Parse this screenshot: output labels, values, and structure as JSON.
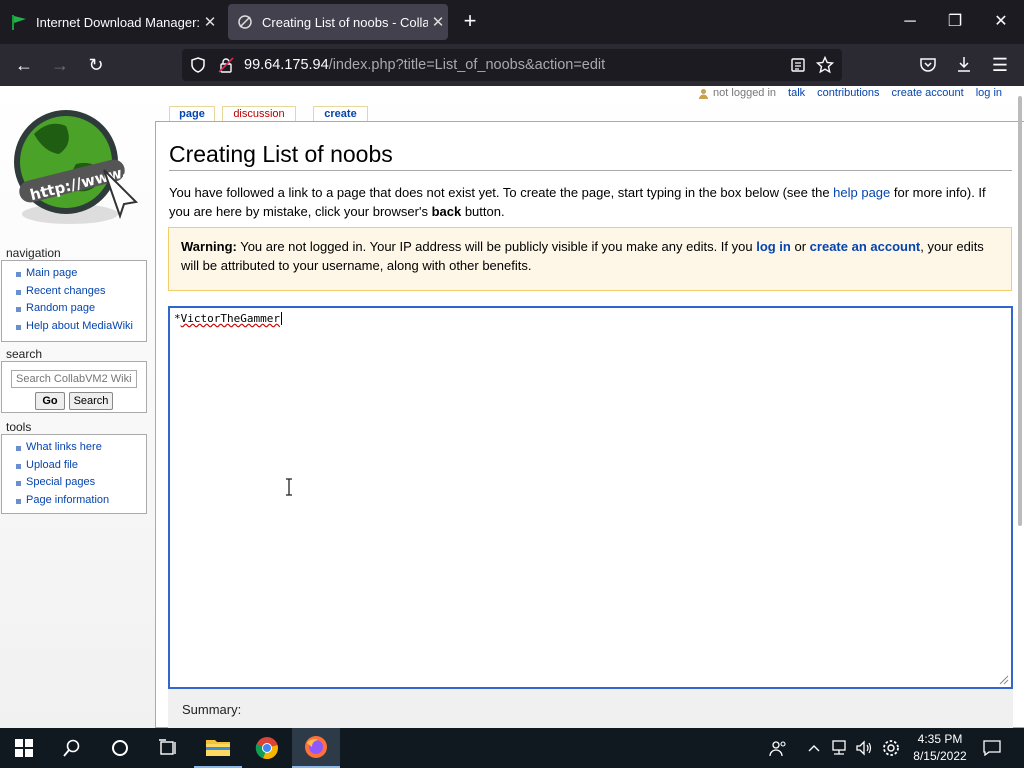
{
  "browser": {
    "tabs": [
      {
        "title": "Internet Download Manager: Th",
        "active": false
      },
      {
        "title": "Creating List of noobs - Collab",
        "active": true
      }
    ],
    "url_host": "99.64.175.94",
    "url_path": "/index.php?title=List_of_noobs&action=edit"
  },
  "personal": {
    "anon": "not logged in",
    "talk": "talk",
    "contributions": "contributions",
    "create_account": "create account",
    "login": "log in"
  },
  "logo_text": "http://www.",
  "navigation": {
    "heading": "navigation",
    "items": [
      "Main page",
      "Recent changes",
      "Random page",
      "Help about MediaWiki"
    ]
  },
  "search": {
    "heading": "search",
    "placeholder": "Search CollabVM2 Wiki",
    "go": "Go",
    "search": "Search"
  },
  "tools": {
    "heading": "tools",
    "items": [
      "What links here",
      "Upload file",
      "Special pages",
      "Page information"
    ]
  },
  "page_tabs": {
    "page": "page",
    "discussion": "discussion",
    "create": "create"
  },
  "content": {
    "title": "Creating List of noobs",
    "intro_1": "You have followed a link to a page that does not exist yet. To create the page, start typing in the box below (see the ",
    "intro_link": "help page",
    "intro_2": " for more info). If you are here by mistake, click your browser's ",
    "intro_bold": "back",
    "intro_3": " button.",
    "warning_label": "Warning:",
    "warning_1": " You are not logged in. Your IP address will be publicly visible if you make any edits. If you ",
    "warning_login": "log in",
    "warning_or": " or ",
    "warning_create": "create an account",
    "warning_2": ", your edits will be attributed to your username, along with other benefits.",
    "editor_prefix": "*",
    "editor_word": "VictorTheGammer",
    "summary_label": "Summary:"
  },
  "taskbar": {
    "time": "4:35 PM",
    "date": "8/15/2022"
  },
  "colors": {
    "link": "#0645ad",
    "editor_border": "#3366cc",
    "warning_bg": "#fef6e7",
    "warning_border": "#f2cd6a"
  }
}
